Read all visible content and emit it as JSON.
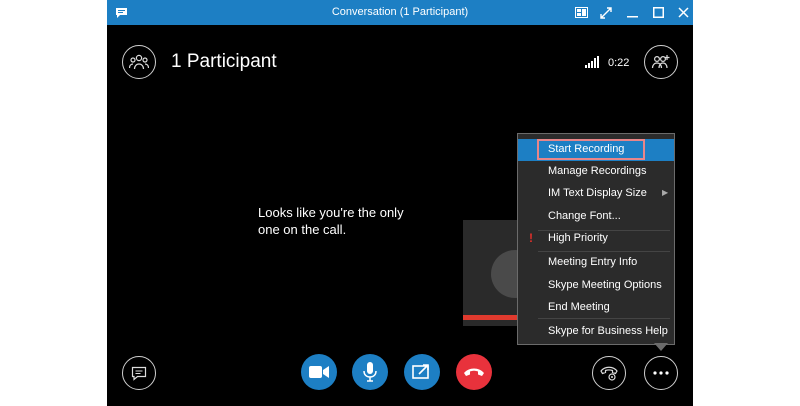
{
  "window": {
    "title": "Conversation (1 Participant)"
  },
  "header": {
    "participants_label": "1 Participant",
    "timer": "0:22"
  },
  "main": {
    "message_line1": "Looks like you're the only",
    "message_line2": "one on the call."
  },
  "menu": {
    "items": [
      {
        "label": "Start Recording"
      },
      {
        "label": "Manage Recordings"
      },
      {
        "label": "IM Text Display Size"
      },
      {
        "label": "Change Font..."
      },
      {
        "label": "High Priority"
      },
      {
        "label": "Meeting Entry Info"
      },
      {
        "label": "Skype Meeting Options"
      },
      {
        "label": "End Meeting"
      },
      {
        "label": "Skype for Business Help"
      }
    ]
  },
  "icons": {
    "chat": "chat-bubble-icon",
    "video": "video-camera-icon",
    "mic": "microphone-icon",
    "share": "share-screen-icon",
    "hangup": "hang-up-icon",
    "call_controls": "call-controls-icon",
    "more": "more-options-icon",
    "add_people": "add-people-icon",
    "participants": "participants-icon"
  },
  "colors": {
    "accent": "#1d7fc4",
    "hangup": "#e8323c",
    "highlight_box": "#e8868a",
    "priority": "#e0302a"
  }
}
